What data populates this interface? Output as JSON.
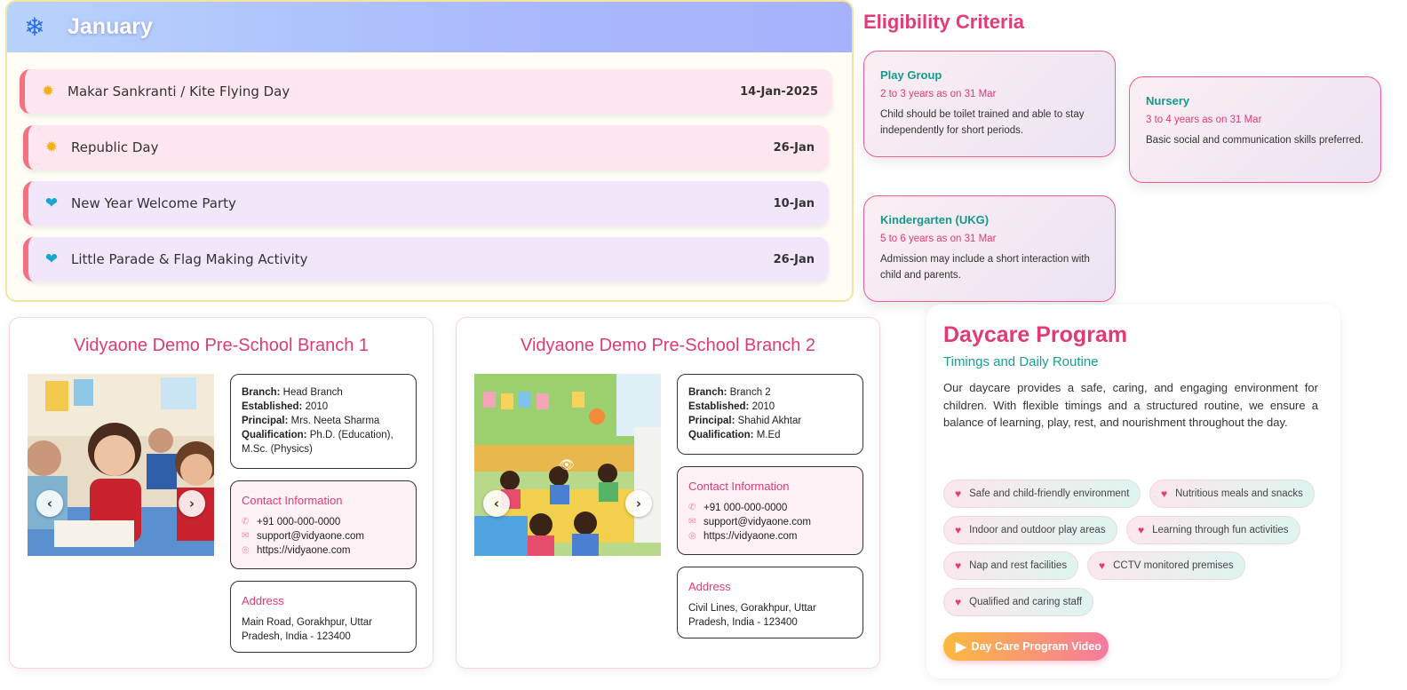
{
  "january": {
    "title": "January",
    "header_icon": "snowflake-icon",
    "events": [
      {
        "name": "Makar Sankranti / Kite Flying Day",
        "date": "14-Jan-2025",
        "icon": "sun-icon",
        "bg": "#fde6ef"
      },
      {
        "name": "Republic Day",
        "date": "26-Jan",
        "icon": "sun-icon",
        "bg": "#fde6ef"
      },
      {
        "name": "New Year Welcome Party",
        "date": "10-Jan",
        "icon": "balloon-icon",
        "bg": "#f2e6fb"
      },
      {
        "name": "Little Parade & Flag Making Activity",
        "date": "26-Jan",
        "icon": "balloon-icon",
        "bg": "#f2e6fb"
      }
    ]
  },
  "eligibility": {
    "title": "Eligibility Criteria",
    "cards": [
      {
        "title": "Play Group",
        "age": "2 to 3 years as on 31 Mar",
        "desc": "Child should be toilet trained and able to stay independently for short periods."
      },
      {
        "title": "Nursery",
        "age": "3 to 4 years as on 31 Mar",
        "desc": "Basic social and communication skills preferred."
      },
      {
        "title": "Kindergarten (UKG)",
        "age": "5 to 6 years as on 31 Mar",
        "desc": "Admission may include a short interaction with child and parents."
      }
    ]
  },
  "branches": [
    {
      "title": "Vidyaone Demo Pre-School Branch 1",
      "branch_label": "Branch:",
      "branch": "Head Branch",
      "established_label": "Established:",
      "established": "2010",
      "principal_label": "Principal:",
      "principal": "Mrs. Neeta Sharma",
      "qualification_label": "Qualification:",
      "qualification": "Ph.D. (Education), M.Sc. (Physics)",
      "contact_title": "Contact Information",
      "phone": "+91 000-000-0000",
      "email": "support@vidyaone.com",
      "website": "https://vidyaone.com",
      "address_title": "Address",
      "address": "Main Road, Gorakhpur, Uttar Pradesh, India - 123400"
    },
    {
      "title": "Vidyaone Demo Pre-School Branch 2",
      "branch_label": "Branch:",
      "branch": "Branch 2",
      "established_label": "Established:",
      "established": "2010",
      "principal_label": "Principal:",
      "principal": "Shahid Akhtar",
      "qualification_label": "Qualification:",
      "qualification": "M.Ed",
      "contact_title": "Contact Information",
      "phone": "+91 000-000-0000",
      "email": "support@vidyaone.com",
      "website": "https://vidyaone.com",
      "address_title": "Address",
      "address": "Civil Lines, Gorakhpur, Uttar Pradesh, India - 123400"
    }
  ],
  "daycare": {
    "title": "Daycare Program",
    "subtitle": "Timings and Daily Routine",
    "description": "Our daycare provides a safe, caring, and engaging environment for children. With flexible timings and a structured routine, we ensure a balance of learning, play, rest, and nourishment throughout the day.",
    "features": [
      "Safe and child-friendly environment",
      "Nutritious meals and snacks",
      "Indoor and outdoor play areas",
      "Learning through fun activities",
      "Nap and rest facilities",
      "CCTV monitored premises",
      "Qualified and caring staff"
    ],
    "video_button": "Day Care Program Video"
  },
  "colors": {
    "accent_pink": "#e23b76",
    "accent_teal": "#149a8d",
    "event_border": "#f4727f"
  }
}
